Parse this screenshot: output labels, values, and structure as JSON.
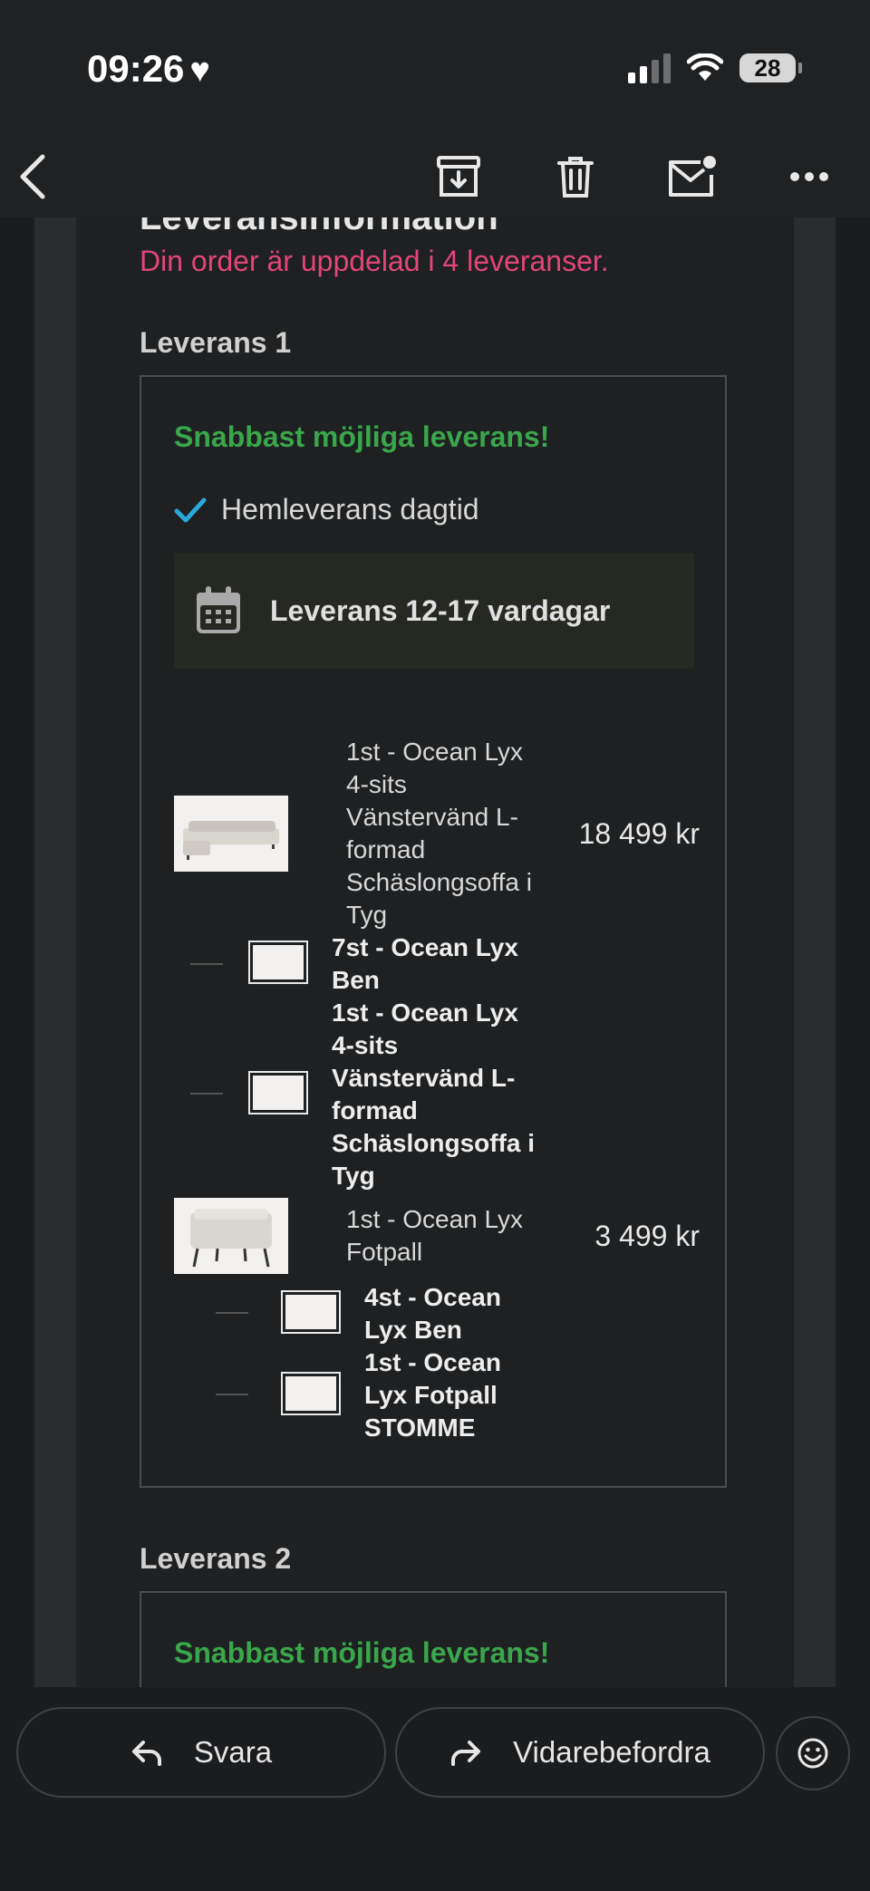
{
  "status": {
    "time": "09:26",
    "battery": "28"
  },
  "email": {
    "partial_heading": "Leveransinformation",
    "notice": "Din order är uppdelad i 4 leveranser.",
    "deliveries": [
      {
        "heading": "Leverans 1",
        "badge": "Snabbast möjliga leverans!",
        "option": "Hemleverans dagtid",
        "eta": "Leverans 12-17 vardagar",
        "products": [
          {
            "name": "1st - Ocean Lyx 4-sits Vänstervänd L-formad Schäslongsoffa i Tyg",
            "price": "18 499 kr",
            "parts": [
              {
                "name": "7st - Ocean Lyx Ben"
              },
              {
                "name": "1st - Ocean Lyx 4-sits Vänstervänd L-formad Schäslongsoffa i Tyg"
              }
            ]
          },
          {
            "name": "1st - Ocean Lyx Fotpall",
            "price": "3 499 kr",
            "parts": [
              {
                "name": "4st - Ocean Lyx Ben"
              },
              {
                "name": "1st - Ocean Lyx Fotpall STOMME"
              }
            ]
          }
        ]
      },
      {
        "heading": "Leverans 2",
        "badge": "Snabbast möjliga leverans!"
      }
    ]
  },
  "actions": {
    "reply": "Svara",
    "forward": "Vidarebefordra"
  }
}
